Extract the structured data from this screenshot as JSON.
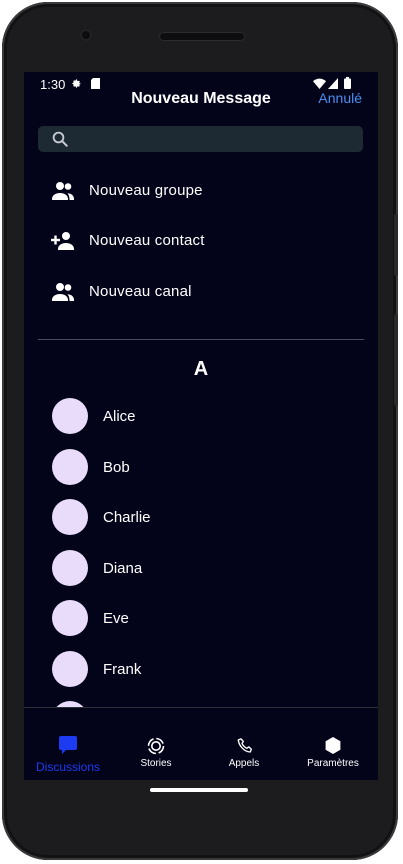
{
  "status_bar": {
    "time": "1:30",
    "icons": [
      "settings-gear-icon",
      "sd-card-icon",
      "wifi-icon",
      "signal-icon",
      "battery-icon"
    ]
  },
  "header": {
    "title": "Nouveau Message",
    "cancel_label": "Annulé"
  },
  "search": {
    "placeholder": "",
    "icon": "search-icon"
  },
  "actions": [
    {
      "label": "Nouveau groupe",
      "icon": "group-icon"
    },
    {
      "label": "Nouveau contact",
      "icon": "add-person-icon"
    },
    {
      "label": "Nouveau canal",
      "icon": "group-icon"
    }
  ],
  "contacts": {
    "section_letter": "A",
    "items": [
      {
        "name": "Alice"
      },
      {
        "name": "Bob"
      },
      {
        "name": "Charlie"
      },
      {
        "name": "Diana"
      },
      {
        "name": "Eve"
      },
      {
        "name": "Frank"
      }
    ]
  },
  "bottom_nav": {
    "items": [
      {
        "label": "Discussions",
        "icon": "chat-bubble-icon",
        "active": true
      },
      {
        "label": "Stories",
        "icon": "stories-icon",
        "active": false
      },
      {
        "label": "Appels",
        "icon": "phone-icon",
        "active": false
      },
      {
        "label": "Paramètres",
        "icon": "hexagon-icon",
        "active": false
      }
    ]
  },
  "colors": {
    "background": "#03041a",
    "accent_active": "#1d3bf0",
    "cancel_link": "#4a8ef0",
    "avatar": "#e9dcfb",
    "search_bg": "#1e2a33"
  }
}
